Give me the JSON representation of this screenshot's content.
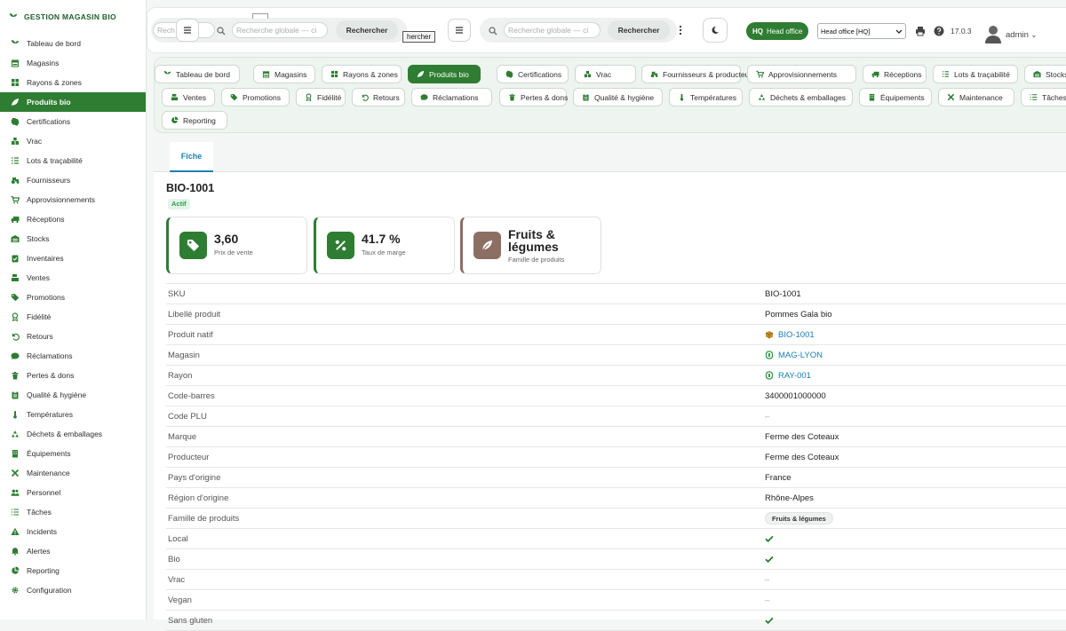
{
  "brand": {
    "title": "GESTION MAGASIN BIO"
  },
  "sidebar": {
    "items": [
      {
        "label": "Tableau de bord",
        "icon": "sprout-icon"
      },
      {
        "label": "Magasins",
        "icon": "store-icon"
      },
      {
        "label": "Rayons & zones",
        "icon": "grid-icon"
      },
      {
        "label": "Produits bio",
        "icon": "leaf-icon",
        "active": true
      },
      {
        "label": "Certifications",
        "icon": "certificate-icon"
      },
      {
        "label": "Vrac",
        "icon": "bulk-icon"
      },
      {
        "label": "Lots & traçabilité",
        "icon": "list-icon"
      },
      {
        "label": "Fournisseurs",
        "icon": "tractor-icon"
      },
      {
        "label": "Approvisionnements",
        "icon": "cart-icon"
      },
      {
        "label": "Réceptions",
        "icon": "truck-icon"
      },
      {
        "label": "Stocks",
        "icon": "warehouse-icon"
      },
      {
        "label": "Inventaires",
        "icon": "clipboard-check-icon"
      },
      {
        "label": "Ventes",
        "icon": "cash-register-icon"
      },
      {
        "label": "Promotions",
        "icon": "tags-icon"
      },
      {
        "label": "Fidélité",
        "icon": "award-icon"
      },
      {
        "label": "Retours",
        "icon": "undo-icon"
      },
      {
        "label": "Réclamations",
        "icon": "comment-icon"
      },
      {
        "label": "Pertes & dons",
        "icon": "trash-icon"
      },
      {
        "label": "Qualité & hygiène",
        "icon": "clipboard-icon"
      },
      {
        "label": "Températures",
        "icon": "thermometer-icon"
      },
      {
        "label": "Déchets & emballages",
        "icon": "recycle-icon"
      },
      {
        "label": "Équipements",
        "icon": "building-icon"
      },
      {
        "label": "Maintenance",
        "icon": "tools-icon"
      },
      {
        "label": "Personnel",
        "icon": "users-icon"
      },
      {
        "label": "Tâches",
        "icon": "tasks-icon"
      },
      {
        "label": "Incidents",
        "icon": "warning-icon"
      },
      {
        "label": "Alertes",
        "icon": "bell-icon"
      },
      {
        "label": "Reporting",
        "icon": "chart-pie-icon"
      },
      {
        "label": "Configuration",
        "icon": "gear-icon"
      }
    ]
  },
  "topbar": {
    "search_left_fragment": "Rech",
    "search_left_suffix": "g",
    "search_placeholder": "Recherche globale — ci",
    "search_button": "Rechercher",
    "tooltip": "hercher",
    "search2_placeholder": "Recherche globale — ci",
    "search2_button": "Rechercher",
    "hq_code": "HQ",
    "hq_label": "Head office",
    "store_select_value": "Head office [HQ]",
    "version": "17.0.3",
    "user": "admin"
  },
  "modules": {
    "row1": [
      {
        "label": "Tableau de bord",
        "icon": "sprout-icon"
      },
      {
        "label": "Magasins",
        "icon": "store-icon"
      },
      {
        "label": "Rayons & zones",
        "icon": "grid-icon"
      },
      {
        "label": "Produits bio",
        "icon": "leaf-icon",
        "active": true
      },
      {
        "label": "Certifications",
        "icon": "certificate-icon"
      },
      {
        "label": "Vrac",
        "icon": "bulk-icon"
      },
      {
        "label": "Fournisseurs & producteurs",
        "icon": "tractor-icon"
      },
      {
        "label": "Approvisionnements",
        "icon": "cart-icon"
      },
      {
        "label": "Réceptions",
        "icon": "truck-icon"
      },
      {
        "label": "Lots & traçabilité",
        "icon": "list-icon"
      },
      {
        "label": "Stocks",
        "icon": "warehouse-icon"
      }
    ],
    "row2": [
      {
        "label": "Ventes",
        "icon": "cash-register-icon"
      },
      {
        "label": "Promotions",
        "icon": "tags-icon"
      },
      {
        "label": "Fidélité",
        "icon": "award-icon"
      },
      {
        "label": "Retours",
        "icon": "undo-icon"
      },
      {
        "label": "Réclamations",
        "icon": "comment-icon"
      },
      {
        "label": "Pertes & dons",
        "icon": "trash-icon"
      },
      {
        "label": "Qualité & hygiène",
        "icon": "clipboard-icon"
      },
      {
        "label": "Températures",
        "icon": "thermometer-icon"
      },
      {
        "label": "Déchets & emballages",
        "icon": "recycle-icon"
      },
      {
        "label": "Équipements",
        "icon": "building-icon"
      },
      {
        "label": "Maintenance",
        "icon": "tools-icon"
      },
      {
        "label": "Tâches",
        "icon": "tasks-icon"
      }
    ],
    "row3": [
      {
        "label": "Reporting",
        "icon": "chart-pie-icon"
      }
    ]
  },
  "record": {
    "tab": "Fiche",
    "title": "BIO-1001",
    "status": "Actif",
    "kpis": [
      {
        "value": "3,60",
        "label": "Prix de vente",
        "icon": "tag-icon"
      },
      {
        "value": "41.7 %",
        "label": "Taux de marge",
        "icon": "percent-icon"
      },
      {
        "value": "Fruits & légumes",
        "label": "Famille de produits",
        "icon": "leaf-icon",
        "color": "#8d6e63"
      }
    ],
    "properties": [
      {
        "key": "SKU",
        "value": "BIO-1001",
        "type": "text"
      },
      {
        "key": "Libellé produit",
        "value": "Pommes Gala bio",
        "type": "text"
      },
      {
        "key": "Produit natif",
        "value": "BIO-1001",
        "type": "link",
        "icon": "box-icon"
      },
      {
        "key": "Magasin",
        "value": "MAG-LYON",
        "type": "link",
        "icon": "record-link-icon"
      },
      {
        "key": "Rayon",
        "value": "RAY-001",
        "type": "link",
        "icon": "record-link-icon"
      },
      {
        "key": "Code-barres",
        "value": "3400001000000",
        "type": "text"
      },
      {
        "key": "Code PLU",
        "value": "–",
        "type": "empty"
      },
      {
        "key": "Marque",
        "value": "Ferme des Coteaux",
        "type": "text"
      },
      {
        "key": "Producteur",
        "value": "Ferme des Coteaux",
        "type": "text"
      },
      {
        "key": "Pays d'origine",
        "value": "France",
        "type": "text"
      },
      {
        "key": "Région d'origine",
        "value": "Rhône-Alpes",
        "type": "text"
      },
      {
        "key": "Famille de produits",
        "value": "Fruits & légumes",
        "type": "tag"
      },
      {
        "key": "Local",
        "value": true,
        "type": "bool"
      },
      {
        "key": "Bio",
        "value": true,
        "type": "bool"
      },
      {
        "key": "Vrac",
        "value": "–",
        "type": "empty"
      },
      {
        "key": "Vegan",
        "value": "–",
        "type": "empty"
      },
      {
        "key": "Sans gluten",
        "value": true,
        "type": "bool"
      }
    ]
  },
  "colors": {
    "primary": "#2e7d32",
    "link": "#1a7fb5",
    "brown": "#8d6e63"
  }
}
